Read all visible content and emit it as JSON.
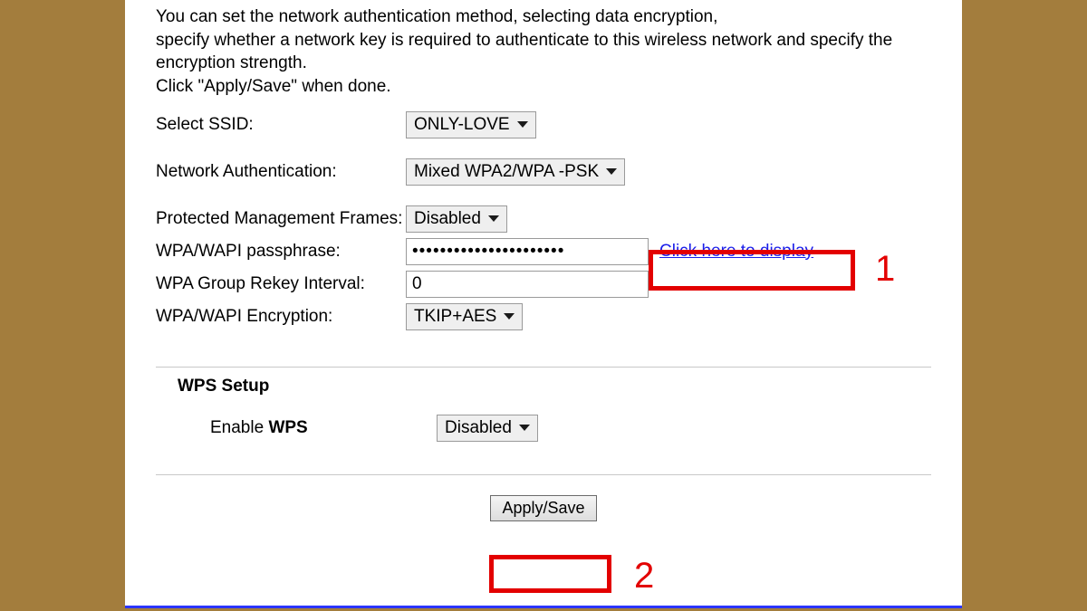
{
  "intro_line1": "You can set the network authentication method, selecting data encryption,",
  "intro_line2": "specify whether a network key is required to authenticate to this wireless network and specify the encryption strength.",
  "intro_line3": "Click \"Apply/Save\" when done.",
  "labels": {
    "ssid": "Select SSID:",
    "auth": "Network Authentication:",
    "pmf": "Protected Management Frames:",
    "passphrase": "WPA/WAPI passphrase:",
    "rekey": "WPA Group Rekey Interval:",
    "encryption": "WPA/WAPI Encryption:"
  },
  "values": {
    "ssid": "ONLY-LOVE",
    "auth": "Mixed WPA2/WPA -PSK",
    "pmf": "Disabled",
    "passphrase_masked": "••••••••••••••••••••••",
    "rekey": "0",
    "encryption": "TKIP+AES",
    "display_link": "Click here to display"
  },
  "wps": {
    "section_title": "WPS Setup",
    "enable_label_pre": "Enable ",
    "enable_label_bold": "WPS",
    "value": "Disabled"
  },
  "apply_save": "Apply/Save",
  "annotations": {
    "num1": "1",
    "num2": "2"
  }
}
